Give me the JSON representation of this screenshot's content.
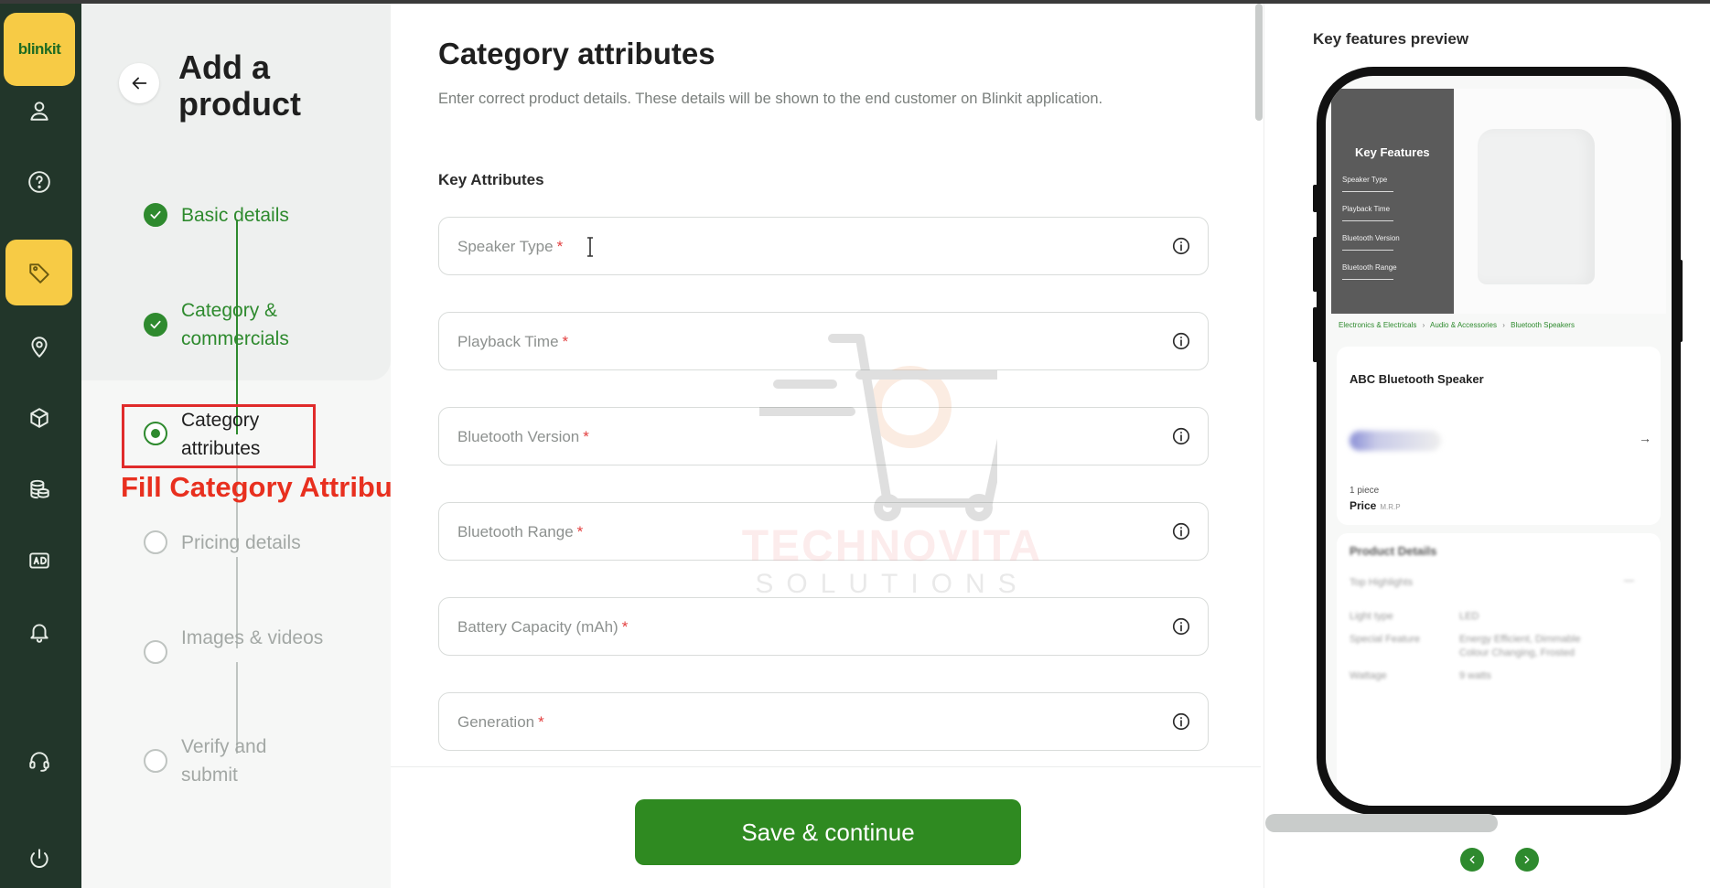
{
  "brand": {
    "logo_text": "blinkit",
    "accent": "#2e8a2e",
    "logo_bg": "#f7cb45",
    "rail_bg": "#22362a"
  },
  "rail": {
    "icons": [
      "user-icon",
      "help-icon",
      "tag-icon",
      "location-pin-icon",
      "box-icon",
      "coins-icon",
      "ad-icon",
      "bell-icon",
      "headset-icon",
      "power-icon"
    ],
    "active": "tag-icon"
  },
  "stepper": {
    "title": "Add a product",
    "steps": [
      {
        "label": "Basic details",
        "status": "done"
      },
      {
        "label": "Category & commercials",
        "status": "done"
      },
      {
        "label": "Category attributes",
        "status": "current"
      },
      {
        "label": "Pricing details",
        "status": "pending"
      },
      {
        "label": "Images & videos",
        "status": "pending"
      },
      {
        "label": "Verify and submit",
        "status": "pending"
      }
    ],
    "annotation": "Fill Category Attributes"
  },
  "form": {
    "title": "Category attributes",
    "subtitle": "Enter correct product details. These details will be shown to the end customer on Blinkit application.",
    "section": "Key Attributes",
    "fields": [
      {
        "label": "Speaker Type",
        "required": "*"
      },
      {
        "label": "Playback Time",
        "required": "*"
      },
      {
        "label": "Bluetooth Version",
        "required": "*"
      },
      {
        "label": "Bluetooth Range",
        "required": "*"
      },
      {
        "label": "Battery Capacity (mAh)",
        "required": "*"
      },
      {
        "label": "Generation",
        "required": "*"
      }
    ],
    "save_label": "Save & continue"
  },
  "watermark": {
    "line1": "TECHNOVITA",
    "line2": "SOLUTIONS"
  },
  "preview": {
    "title": "Key features preview",
    "key_features_title": "Key Features",
    "key_features": [
      "Speaker Type",
      "Playback Time",
      "Bluetooth Version",
      "Bluetooth Range"
    ],
    "breadcrumb": [
      "Electronics & Electricals",
      "Audio & Accessories",
      "Bluetooth Speakers"
    ],
    "breadcrumb_sep": "›",
    "product_name": "ABC Bluetooth Speaker",
    "quantity": "1 piece",
    "price_label": "Price",
    "mrp_label": "M.R.P",
    "details_title": "Product Details",
    "details_sub": "Top Highlights",
    "details_rows": [
      {
        "key": "Light type",
        "value": "LED"
      },
      {
        "key": "Special Feature",
        "value": "Energy Efficient, Dimmable"
      },
      {
        "key": "",
        "value": "Colour Changing, Frosted"
      },
      {
        "key": "Wattage",
        "value": "9 watts"
      }
    ]
  }
}
